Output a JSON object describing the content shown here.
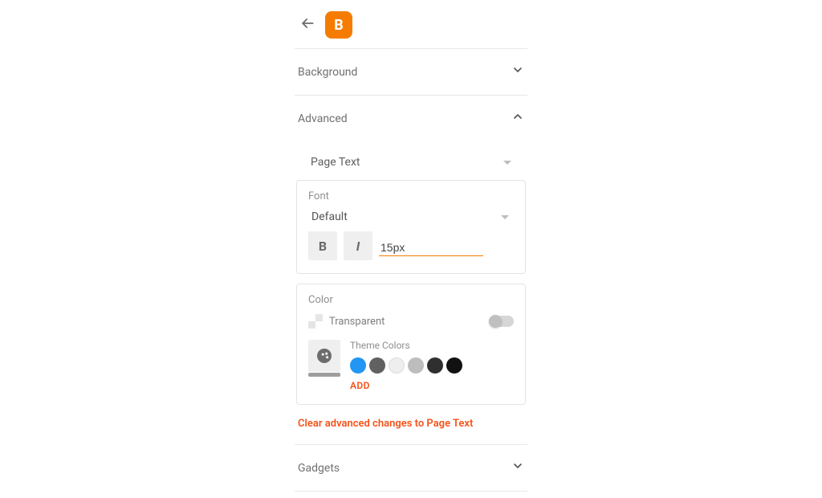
{
  "header": {
    "logo_letter": "B"
  },
  "sections": {
    "background": {
      "label": "Background"
    },
    "advanced": {
      "label": "Advanced"
    },
    "gadgets": {
      "label": "Gadgets"
    }
  },
  "advanced": {
    "target_selector": "Page Text",
    "font": {
      "title": "Font",
      "family": "Default",
      "bold_label": "B",
      "italic_label": "I",
      "size": "15px"
    },
    "color": {
      "title": "Color",
      "transparent_label": "Transparent",
      "theme_label": "Theme Colors",
      "swatches": [
        "#2196f3",
        "#616161",
        "#eeeeee",
        "#bdbdbd",
        "#2f2f2f",
        "#111111"
      ],
      "add_label": "ADD"
    },
    "clear_label": "Clear advanced changes to Page Text"
  }
}
